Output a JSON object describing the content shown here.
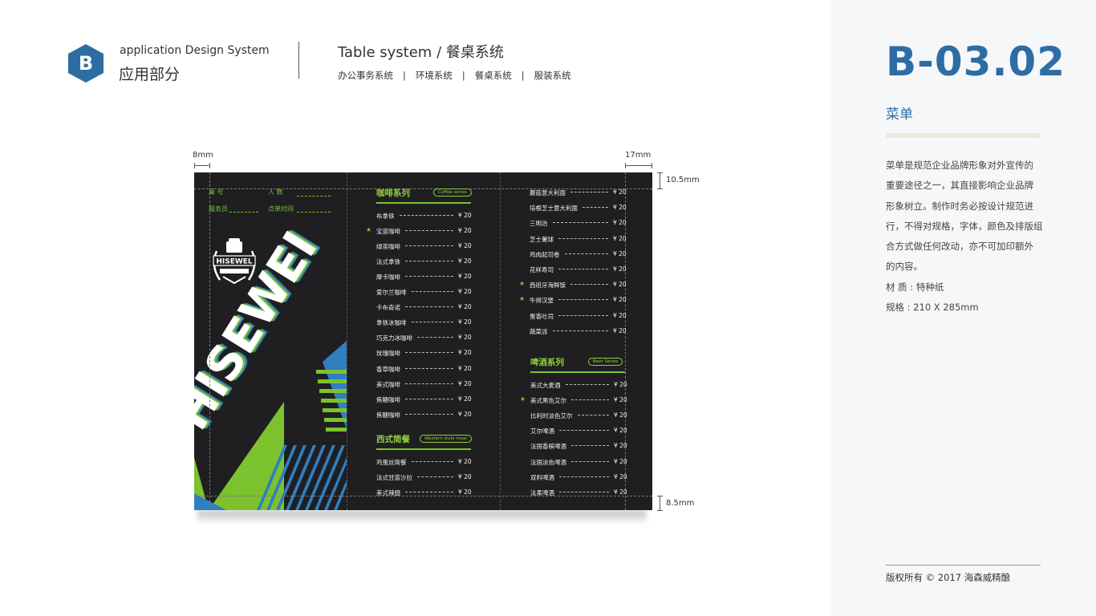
{
  "header": {
    "brand_letter": "B",
    "brand_sub": "application Design System",
    "brand_main": "应用部分",
    "section_title": "Table system /  餐桌系统",
    "nav": [
      "办公事务系统",
      "环境系统",
      "餐桌系统",
      "服装系统"
    ],
    "nav_sep": "|"
  },
  "panel": {
    "code": "B-03.02",
    "title": "菜单",
    "description": [
      "菜单是规范企业品牌形象对外宣传的",
      "重要途径之一，其直接影响企业品牌",
      "形象树立。制作时务必按设计规范进",
      "行，不得对规格，字体，颜色及排版组",
      "合方式做任何改动，亦不可加印额外",
      "的内容。",
      "材 质 : 特种纸",
      "规格 : 210 X 285mm"
    ],
    "footer": "版权所有 ©    2017      海森威精酿"
  },
  "dimensions": {
    "left": "8mm",
    "right": "17mm",
    "top": "10.5mm",
    "bottom": "8.5mm"
  },
  "menu": {
    "fields": {
      "table_no": "桌    号",
      "guests": "人    数",
      "waiter": "服务员",
      "order_time": "点单时间"
    },
    "logo_text": "HISEWEL",
    "big_text": "HISEWEI",
    "colors": {
      "green": "#7cc22e",
      "blue": "#2f7fc1",
      "board": "#1f1f22"
    },
    "coffee": {
      "title": "咖啡系列",
      "tag": "Coffee series",
      "items": [
        {
          "name": "布拿铁",
          "price": "¥ 20",
          "star": false
        },
        {
          "name": "宝蓝咖啡",
          "price": "¥ 20",
          "star": true
        },
        {
          "name": "绿茶咖啡",
          "price": "¥ 20",
          "star": false
        },
        {
          "name": "法式拿铁",
          "price": "¥ 20",
          "star": false
        },
        {
          "name": "摩卡咖啡",
          "price": "¥ 20",
          "star": false
        },
        {
          "name": "爱尔兰咖啡",
          "price": "¥ 20",
          "star": false
        },
        {
          "name": "卡布奇诺",
          "price": "¥ 20",
          "star": false
        },
        {
          "name": "拿铁冰咖啡",
          "price": "¥ 20",
          "star": false
        },
        {
          "name": "巧克力冰咖啡",
          "price": "¥ 20",
          "star": false
        },
        {
          "name": "玫瑰咖啡",
          "price": "¥ 20",
          "star": false
        },
        {
          "name": "香草咖啡",
          "price": "¥ 20",
          "star": false
        },
        {
          "name": "美式咖啡",
          "price": "¥ 20",
          "star": false
        },
        {
          "name": "焦糖咖啡",
          "price": "¥ 20",
          "star": false
        },
        {
          "name": "焦糖咖啡",
          "price": "¥ 20",
          "star": false
        }
      ]
    },
    "western": {
      "title": "西式简餐",
      "tag": "Western style meal",
      "items": [
        {
          "name": "鸡蛋丝简餐",
          "price": "¥ 20",
          "star": false
        },
        {
          "name": "法式甘蓝沙拉",
          "price": "¥ 20",
          "star": false
        },
        {
          "name": "美式辣翅",
          "price": "¥ 20",
          "star": false
        }
      ]
    },
    "food": {
      "items": [
        {
          "name": "蘑菇意大利面",
          "price": "¥ 20",
          "star": false
        },
        {
          "name": "培根芝士意大利面",
          "price": "¥ 20",
          "star": false
        },
        {
          "name": "三明治",
          "price": "¥ 20",
          "star": false
        },
        {
          "name": "芝士薯球",
          "price": "¥ 20",
          "star": false
        },
        {
          "name": "鸡肉起司卷",
          "price": "¥ 20",
          "star": false
        },
        {
          "name": "花样寿司",
          "price": "¥ 20",
          "star": false
        },
        {
          "name": "西班牙海鲜饭",
          "price": "¥ 20",
          "star": true
        },
        {
          "name": "牛排汉堡",
          "price": "¥ 20",
          "star": true
        },
        {
          "name": "蛋香吐司",
          "price": "¥ 20",
          "star": false
        },
        {
          "name": "蔬菜派",
          "price": "¥ 20",
          "star": false
        }
      ]
    },
    "beer": {
      "title": "啤酒系列",
      "tag": "Beer Series",
      "items": [
        {
          "name": "美式大麦酒",
          "price": "¥ 20",
          "star": false
        },
        {
          "name": "美式黑色艾尔",
          "price": "¥ 20",
          "star": true
        },
        {
          "name": "比利时淡色艾尔",
          "price": "¥ 20",
          "star": false
        },
        {
          "name": "艾尔啤酒",
          "price": "¥ 20",
          "star": false
        },
        {
          "name": "法国香槟啤酒",
          "price": "¥ 20",
          "star": false
        },
        {
          "name": "法国淡色啤酒",
          "price": "¥ 20",
          "star": false
        },
        {
          "name": "双料啤酒",
          "price": "¥ 20",
          "star": false
        },
        {
          "name": "法柔啤酒",
          "price": "¥ 20",
          "star": false
        }
      ]
    }
  }
}
